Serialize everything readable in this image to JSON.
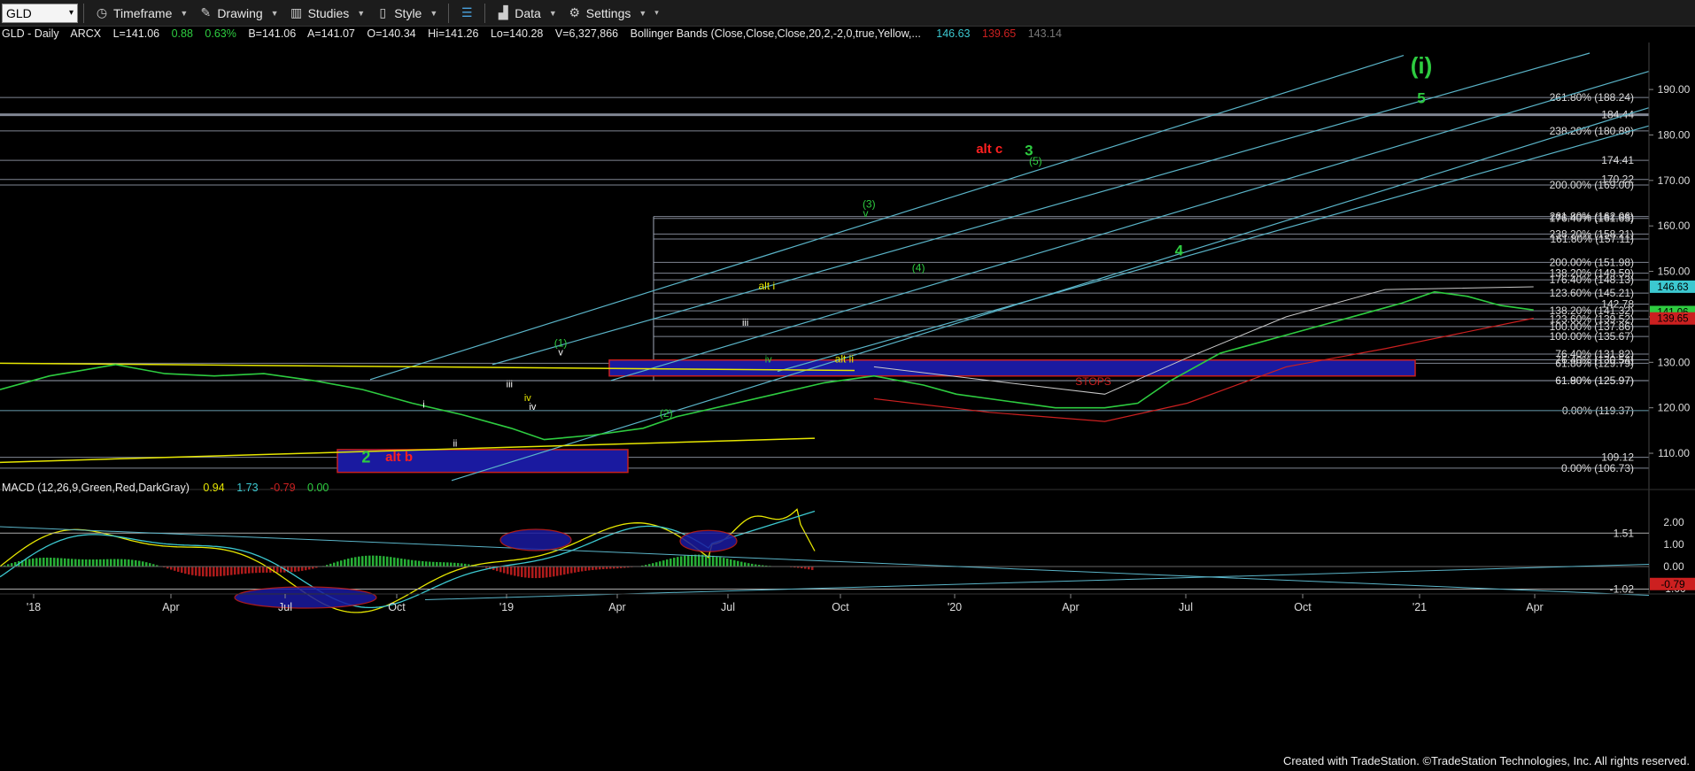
{
  "toolbar": {
    "symbol": "GLD",
    "timeframe": "Timeframe",
    "drawing": "Drawing",
    "studies": "Studies",
    "style": "Style",
    "data": "Data",
    "settings": "Settings"
  },
  "header": {
    "symbol": "GLD - Daily",
    "exchange": "ARCX",
    "last": "L=141.06",
    "change": "0.88",
    "change_pct": "0.63%",
    "bid": "B=141.06",
    "ask": "A=141.07",
    "open": "O=140.34",
    "high": "Hi=141.26",
    "low": "Lo=140.28",
    "volume": "V=6,327,866",
    "study": "Bollinger Bands (Close,Close,Close,20,2,-2,0,true,Yellow,...",
    "bb_upper": "146.63",
    "bb_lower": "139.65",
    "bb_mid": "143.14"
  },
  "macd_header": {
    "label": "MACD (12,26,9,Green,Red,DarkGray)",
    "macd": "0.94",
    "signal": "1.73",
    "hist": "-0.79",
    "zero": "0.00"
  },
  "footer": "Created with TradeStation. ©TradeStation Technologies, Inc. All rights reserved.",
  "colors": {
    "price_line": "#2ecc40",
    "wave_green": "#2ecc40",
    "wave_red": "#ff2020",
    "yellow": "#e6e600",
    "channel": "#5ab4c8",
    "fib_line": "#a0a8b8",
    "blue_box": "#1a1aa0",
    "bb_band": "#c8c8c8",
    "bb_lower": "#cc2020"
  },
  "chart_data": {
    "type": "line",
    "x_ticks": [
      "'18",
      "Apr",
      "Jul",
      "Oct",
      "'19",
      "Apr",
      "Jul",
      "Oct",
      "'20",
      "Apr",
      "Jul",
      "Oct",
      "'21",
      "Apr"
    ],
    "price_axis": {
      "ylim": [
        103,
        198
      ],
      "ticks": [
        "190.00",
        "180.00",
        "170.00",
        "160.00",
        "150.00",
        "140.00",
        "130.00",
        "120.00",
        "110.00"
      ]
    },
    "price_series": [
      [
        0,
        124
      ],
      [
        0.03,
        127
      ],
      [
        0.07,
        129.5
      ],
      [
        0.1,
        127.5
      ],
      [
        0.13,
        127
      ],
      [
        0.16,
        127.5
      ],
      [
        0.19,
        126
      ],
      [
        0.22,
        124
      ],
      [
        0.25,
        121
      ],
      [
        0.28,
        118.5
      ],
      [
        0.31,
        115.5
      ],
      [
        0.33,
        113
      ],
      [
        0.36,
        114
      ],
      [
        0.39,
        115.5
      ],
      [
        0.41,
        118
      ],
      [
        0.44,
        120.5
      ],
      [
        0.47,
        123
      ],
      [
        0.5,
        125.5
      ],
      [
        0.53,
        127
      ],
      [
        0.56,
        125
      ],
      [
        0.58,
        123
      ],
      [
        0.61,
        121.5
      ],
      [
        0.64,
        120
      ],
      [
        0.67,
        120
      ],
      [
        0.69,
        121
      ],
      [
        0.71,
        126
      ],
      [
        0.74,
        132
      ],
      [
        0.78,
        136
      ],
      [
        0.81,
        139
      ],
      [
        0.83,
        141
      ],
      [
        0.85,
        143
      ],
      [
        0.87,
        145.5
      ],
      [
        0.89,
        144.5
      ],
      [
        0.91,
        142.5
      ],
      [
        0.93,
        141.5
      ]
    ],
    "bb_upper_series": [
      [
        0.53,
        129
      ],
      [
        0.6,
        126
      ],
      [
        0.67,
        123
      ],
      [
        0.72,
        131
      ],
      [
        0.78,
        140
      ],
      [
        0.84,
        146
      ],
      [
        0.93,
        146.6
      ]
    ],
    "bb_lower_series": [
      [
        0.53,
        122
      ],
      [
        0.6,
        119
      ],
      [
        0.67,
        117
      ],
      [
        0.72,
        121
      ],
      [
        0.78,
        129
      ],
      [
        0.84,
        133
      ],
      [
        0.93,
        139.7
      ]
    ],
    "fib_levels": [
      {
        "label": "261.80% (188.24)",
        "value": 188.24
      },
      {
        "label": "184.44",
        "value": 184.44
      },
      {
        "label": "238.20% (180.89)",
        "value": 180.89
      },
      {
        "label": "174.41",
        "value": 174.41
      },
      {
        "label": "170.22",
        "value": 170.22
      },
      {
        "label": "200.00% (169.00)",
        "value": 169.0
      },
      {
        "label": "261.80% (162.06)",
        "value": 162.06
      },
      {
        "label": "176.40% (161.65)",
        "value": 161.65
      },
      {
        "label": "238.20% (158.21)",
        "value": 158.21
      },
      {
        "label": "161.80% (157.11)",
        "value": 157.11
      },
      {
        "label": "200.00% (151.98)",
        "value": 151.98
      },
      {
        "label": "138.20% (149.59)",
        "value": 149.59
      },
      {
        "label": "176.40% (148.13)",
        "value": 148.13
      },
      {
        "label": "123.60% (145.21)",
        "value": 145.21
      },
      {
        "label": "142.78",
        "value": 142.78
      },
      {
        "label": "138.20% (141.32)",
        "value": 141.32
      },
      {
        "label": "123.60% (139.52)",
        "value": 139.52
      },
      {
        "label": "100.00% (137.86)",
        "value": 137.86
      },
      {
        "label": "100.00% (135.67)",
        "value": 135.67
      },
      {
        "label": "76.40% (131.82)",
        "value": 131.82
      },
      {
        "label": "76.40% (130.54)",
        "value": 130.54
      },
      {
        "label": "61.80% (129.79)",
        "value": 129.79
      },
      {
        "label": "61.80% (125.97)",
        "value": 125.97
      },
      {
        "label": "61.90% (125.97)",
        "value": 125.97
      },
      {
        "label": "0.00% (119.37)",
        "value": 119.37
      },
      {
        "label": "109.12",
        "value": 109.12
      },
      {
        "label": "0.00% (106.73)",
        "value": 106.73
      }
    ],
    "current_price_tags": [
      {
        "label": "146.63",
        "value": 146.63,
        "color": "#3cc8d0"
      },
      {
        "label": "141.06",
        "value": 141.06,
        "color": "#2ecc40"
      },
      {
        "label": "139.65",
        "value": 139.65,
        "color": "#cc2020"
      }
    ],
    "wave_labels": [
      {
        "text": "(i)",
        "x": 0.862,
        "y": 193.5,
        "color": "#2ecc40",
        "size": 26
      },
      {
        "text": "5",
        "x": 0.862,
        "y": 187,
        "color": "#2ecc40",
        "size": 17
      },
      {
        "text": "alt c",
        "x": 0.6,
        "y": 176,
        "color": "#ff2020",
        "size": 15
      },
      {
        "text": "3",
        "x": 0.624,
        "y": 175.5,
        "color": "#2ecc40",
        "size": 17
      },
      {
        "text": "(5)",
        "x": 0.628,
        "y": 173.5,
        "color": "#2ecc40",
        "size": 12
      },
      {
        "text": "(3)",
        "x": 0.527,
        "y": 164,
        "color": "#2ecc40",
        "size": 12
      },
      {
        "text": "v",
        "x": 0.525,
        "y": 162,
        "color": "#2ecc40",
        "size": 12
      },
      {
        "text": "4",
        "x": 0.715,
        "y": 153.5,
        "color": "#2ecc40",
        "size": 17
      },
      {
        "text": "(4)",
        "x": 0.557,
        "y": 150,
        "color": "#2ecc40",
        "size": 12
      },
      {
        "text": "alt i",
        "x": 0.465,
        "y": 146,
        "color": "#e6e600",
        "size": 12
      },
      {
        "text": "iii",
        "x": 0.452,
        "y": 138,
        "color": "#ffffff",
        "size": 11
      },
      {
        "text": "iv",
        "x": 0.466,
        "y": 130,
        "color": "#2ecc40",
        "size": 11
      },
      {
        "text": "alt ii",
        "x": 0.512,
        "y": 130,
        "color": "#e6e600",
        "size": 12
      },
      {
        "text": "(1)",
        "x": 0.34,
        "y": 133.5,
        "color": "#2ecc40",
        "size": 12
      },
      {
        "text": "v",
        "x": 0.34,
        "y": 131.5,
        "color": "#ffffff",
        "size": 11
      },
      {
        "text": "iii",
        "x": 0.309,
        "y": 124.5,
        "color": "#ffffff",
        "size": 11
      },
      {
        "text": "iv",
        "x": 0.323,
        "y": 119.5,
        "color": "#ffffff",
        "size": 11
      },
      {
        "text": "iv",
        "x": 0.32,
        "y": 121.5,
        "color": "#e6e600",
        "size": 11
      },
      {
        "text": "i",
        "x": 0.257,
        "y": 120,
        "color": "#ffffff",
        "size": 11
      },
      {
        "text": "ii",
        "x": 0.276,
        "y": 111.5,
        "color": "#ffffff",
        "size": 11
      },
      {
        "text": "(2)",
        "x": 0.404,
        "y": 118,
        "color": "#2ecc40",
        "size": 12
      },
      {
        "text": "STOPS",
        "x": 0.663,
        "y": 125,
        "color": "#c82020",
        "size": 12
      },
      {
        "text": "2",
        "x": 0.222,
        "y": 108,
        "color": "#2ecc40",
        "size": 18
      },
      {
        "text": "alt b",
        "x": 0.242,
        "y": 108.3,
        "color": "#ff2020",
        "size": 15
      }
    ],
    "macd_axis": {
      "ticks": [
        "2.00",
        "1.00",
        "0.00",
        "-1.00"
      ],
      "tags": [
        "1.51",
        "-1.02",
        "-0.79"
      ]
    }
  }
}
